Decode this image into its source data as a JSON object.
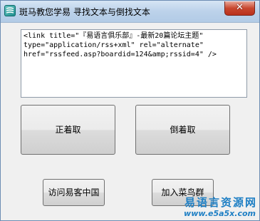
{
  "window": {
    "title": "斑马教您学易 寻找文本与倒找文本",
    "app_icon": "zebra-logo-icon",
    "close_symbol": "✕"
  },
  "editbox": {
    "content": "<link title=\"『易语言俱乐部』-最新20篇论坛主题\" type=\"application/rss+xml\" rel=\"alternate\" href=\"rssfeed.asp?boardid=124&amp;rssid=4\" />"
  },
  "buttons": {
    "forward_label": "正着取",
    "backward_label": "倒着取",
    "visit_label": "访问易客中国",
    "join_label": "加入菜鸟群"
  },
  "watermark": {
    "cn_text": "易语言资源网",
    "url_text": "www.e5a5x.com"
  },
  "colors": {
    "accent": "#1e7fc4",
    "close": "#c8472f"
  }
}
